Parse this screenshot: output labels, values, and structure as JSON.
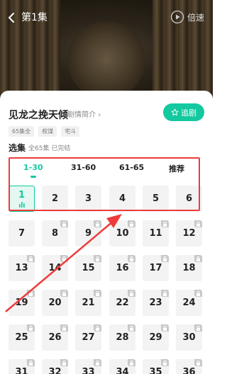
{
  "player": {
    "episode_title": "第1集",
    "speed_label": "倍速"
  },
  "drama": {
    "title": "见龙之挽天倾",
    "intro_label": "剧情简介 ›",
    "follow_label": "追剧",
    "tags": [
      "65集全",
      "权谋",
      "宅斗"
    ]
  },
  "episodes": {
    "section_title": "选集",
    "info": "全65集 已完结",
    "ranges": [
      "1-30",
      "31-60",
      "61-65",
      "推荐"
    ],
    "active_range": 0,
    "active_episode": 1,
    "numbers": [
      "1",
      "2",
      "3",
      "4",
      "5",
      "6",
      "7",
      "8",
      "9",
      "10",
      "11",
      "12",
      "13",
      "14",
      "15",
      "16",
      "17",
      "18",
      "19",
      "20",
      "21",
      "22",
      "23",
      "24",
      "25",
      "26",
      "27",
      "28",
      "29",
      "30",
      "31",
      "32",
      "33",
      "34",
      "35",
      "36"
    ]
  },
  "colors": {
    "accent": "#14c8a0",
    "annotation": "#ee3b3b"
  }
}
